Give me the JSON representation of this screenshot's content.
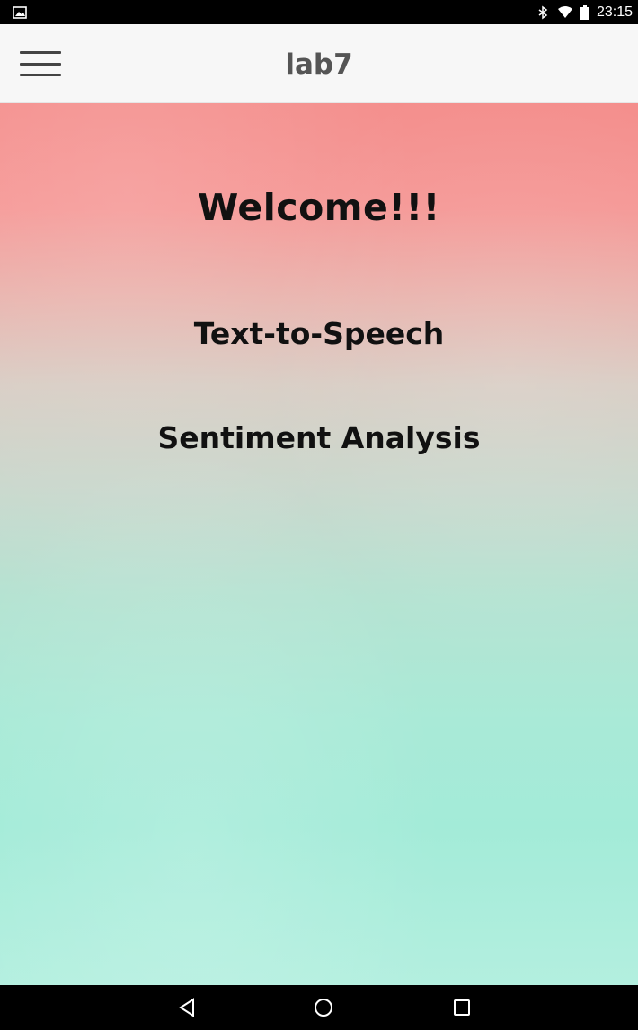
{
  "status_bar": {
    "time": "23:15",
    "icons": [
      "image-icon",
      "bluetooth-icon",
      "wifi-icon",
      "battery-icon"
    ]
  },
  "app_bar": {
    "title": "lab7",
    "menu_icon": "hamburger-menu-icon"
  },
  "main": {
    "welcome": "Welcome!!!",
    "links": [
      {
        "label": "Text-to-Speech"
      },
      {
        "label": "Sentiment Analysis"
      }
    ]
  },
  "nav_bar": {
    "icons": [
      "back-icon",
      "home-icon",
      "recent-apps-icon"
    ]
  },
  "colors": {
    "app_bar_bg": "#f7f7f7",
    "gradient_top": "#f48e8c",
    "gradient_bottom": "#a3ebd8",
    "text": "#111111"
  }
}
